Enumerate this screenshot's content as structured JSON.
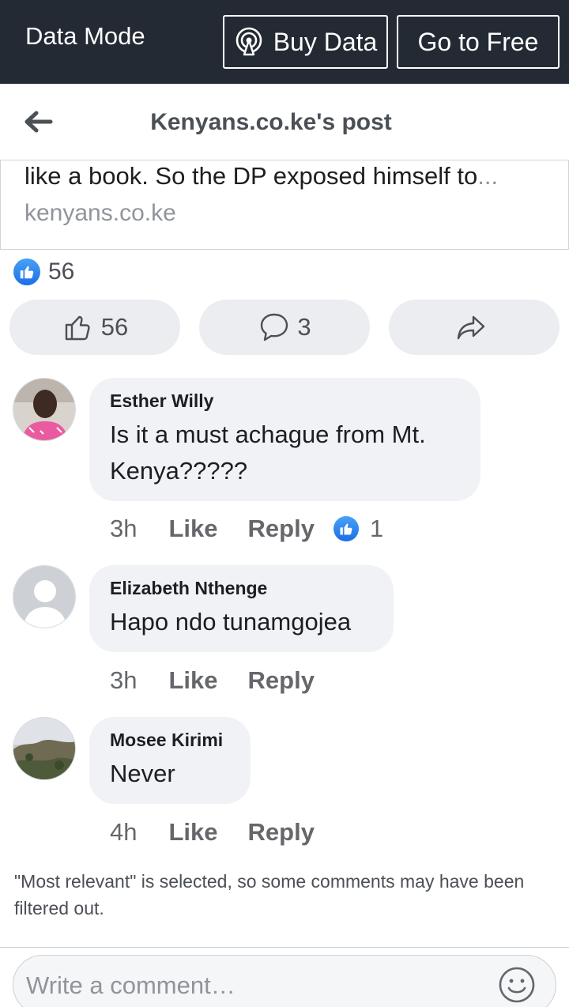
{
  "databar": {
    "mode_label": "Data Mode",
    "buy_label": "Buy Data",
    "free_label": "Go to Free"
  },
  "header": {
    "title": "Kenyans.co.ke's post"
  },
  "preview": {
    "snippet": "like a book. So the DP exposed himself to",
    "ellipsis": "...",
    "domain": "kenyans.co.ke"
  },
  "reactions": {
    "summary_count": "56"
  },
  "actions": {
    "like_count": "56",
    "comment_count": "3"
  },
  "comments": [
    {
      "name": "Esther Willy",
      "text_line1": "Is it a must achague from Mt.",
      "text_line2": "Kenya?????",
      "time": "3h",
      "like": "Like",
      "reply": "Reply",
      "reaction_count": "1"
    },
    {
      "name": "Elizabeth Nthenge",
      "text": "Hapo ndo tunamgojea",
      "time": "3h",
      "like": "Like",
      "reply": "Reply"
    },
    {
      "name": "Mosee Kirimi",
      "text": "Never",
      "time": "4h",
      "like": "Like",
      "reply": "Reply"
    }
  ],
  "filter_note": "\"Most relevant\" is selected, so some comments may have been filtered out.",
  "composer": {
    "placeholder": "Write a comment…"
  },
  "colors": {
    "databar_bg": "#232a33",
    "like_blue": "#1c6ee8",
    "bubble_bg": "#f0f2f5",
    "pill_bg": "#ebedf0"
  },
  "icons": {
    "buy": "broadcast-icon",
    "back": "arrow-left-icon",
    "like": "thumbs-up-icon",
    "comment": "speech-bubble-icon",
    "share": "share-arrow-icon",
    "emoji": "smiley-icon"
  }
}
